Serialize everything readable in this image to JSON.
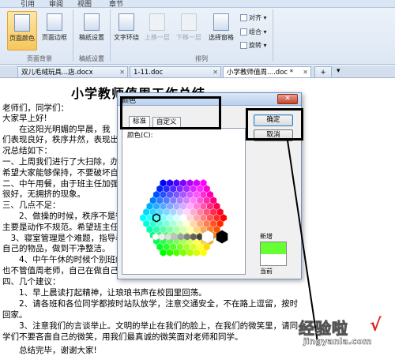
{
  "ribbon": {
    "tabs": [
      "引用",
      "审阅",
      "视图",
      "章节"
    ],
    "buttons": {
      "page_color": "页面颜色",
      "page_border": "页面边框",
      "paper_setting": "稿纸设置",
      "text_wrap": "文字环绕",
      "bring_forward": "上移一层",
      "send_backward": "下移一层",
      "selection_pane": "选择窗格"
    },
    "small_commands": [
      "对齐",
      "组合",
      "旋转"
    ],
    "groups": {
      "page_background": "页面背景",
      "paper": "稿纸设置",
      "arrange": "排列"
    }
  },
  "doc_tabs": [
    {
      "label": "双儿毛绒玩具...店.docx",
      "active": false
    },
    {
      "label": "1-11.doc",
      "active": false
    },
    {
      "label": "小学教师值周....doc *",
      "active": true
    }
  ],
  "doc_tabs_add": "+",
  "document": {
    "title": "小学教师值周工作总结",
    "lines": [
      "老师们，同学们：",
      "大家早上好!",
      "　　在这阳光明媚的早晨，我",
      "们表现良好，秩序井然，表现出",
      "况总结如下：",
      "一、上周我们进行了大扫除，办",
      "希望大家能够保持，不要破坏自",
      "二、中午用餐，由于班主任加强",
      "很好，无拥挤的现象。",
      "三、几点不足：",
      "　　2、做操的时候，秩序不是很",
      "主要是动作不规范。希望班主任",
      "　3、寝室管理是个难题，指导老",
      "自己的物品，做到干净整洁。",
      "　　4、中午午休的时候个别班级",
      "也不管值周老师，自己在做自己",
      "四、几个建议：",
      "　　1、早上晨读打起精神，让琅琅书声在校园里回荡。",
      "　　2、请各班和各位同学都按时站队放学，注意交通安全，不在路上逗留，按时",
      "回家。",
      "　　3、注意我们的言谈举止。文明的举止在我们的脸上，在我们的微笑里，请同",
      "学们不要吝啬自己的微笑，用我们最真诚的微笑面对老师和同学。",
      "　　总结完毕，谢谢大家!"
    ]
  },
  "dialog": {
    "title": "颜色",
    "close": "✕",
    "tabs": [
      "标准",
      "自定义"
    ],
    "colors_label": "颜色(C):",
    "ok": "确定",
    "cancel": "取消",
    "new_label": "新增",
    "current_label": "当前",
    "new_color": "#66ff33",
    "current_color": "#ffffff"
  },
  "watermark": {
    "brand": "经验啦",
    "check": "√",
    "url": "jingyanla.com"
  }
}
